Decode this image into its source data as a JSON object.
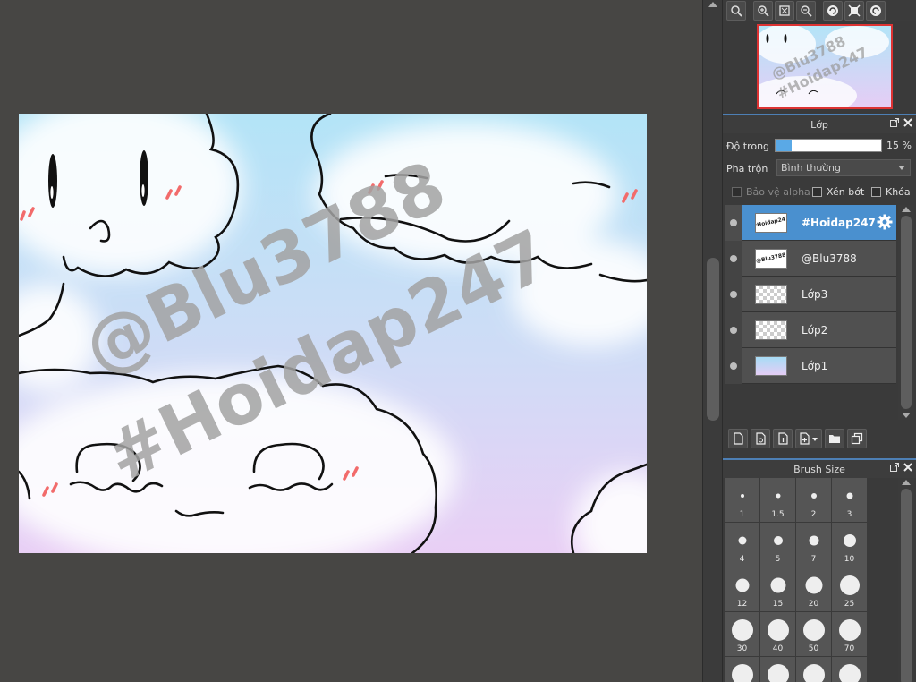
{
  "canvas": {
    "watermark_line1": "@Blu3788",
    "watermark_line2": "#Hoidap247",
    "colors": {
      "sky_top": "#b6e3f6",
      "sky_bottom": "#e9cdf5",
      "blush": "#f06a6a",
      "line": "#111111",
      "watermark": "#9a9a9a"
    }
  },
  "navigator": {
    "tools": [
      "zoom-fit-icon",
      "zoom-in-icon",
      "fit-screen-icon",
      "zoom-out-icon",
      "rotate-left-icon",
      "reset-view-icon",
      "rotate-right-icon"
    ]
  },
  "layer_panel": {
    "title": "Lớp",
    "opacity_label": "Độ trong",
    "opacity_value": "15 %",
    "opacity_fraction": 0.15,
    "blend_label": "Pha trộn",
    "blend_value": "Bình thường",
    "protect_alpha_label": "Bảo vệ alpha",
    "clipping_label": "Xén bớt",
    "lock_label": "Khóa",
    "layers": [
      {
        "name": "#Hoidap247",
        "thumb": "#Hoidap247",
        "active": true
      },
      {
        "name": "@Blu3788",
        "thumb": "@Blu3788",
        "active": false
      },
      {
        "name": "Lớp3",
        "active": false
      },
      {
        "name": "Lớp2",
        "active": false
      },
      {
        "name": "Lớp1",
        "active": false
      }
    ],
    "accent": "#4a90cf"
  },
  "brush_panel": {
    "title": "Brush Size",
    "sizes": [
      "1",
      "1.5",
      "2",
      "3",
      "4",
      "5",
      "7",
      "10",
      "12",
      "15",
      "20",
      "25",
      "30",
      "40",
      "50",
      "70"
    ]
  }
}
